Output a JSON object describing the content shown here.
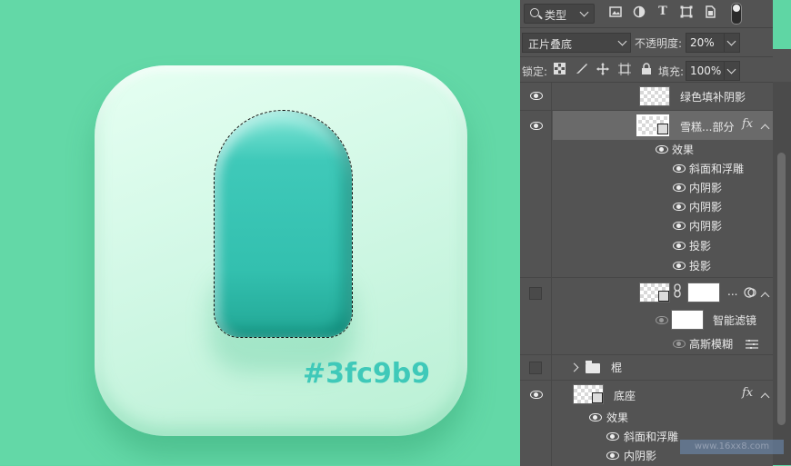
{
  "canvas": {
    "color_label": "#3fc9b9",
    "colors": {
      "background": "#63d8a7",
      "popsicle": "#3fc9b9",
      "base": "#d2f8e6"
    }
  },
  "panel": {
    "filter_kind": "类型",
    "blend_mode": "正片叠底",
    "opacity_label": "不透明度:",
    "opacity_value": "20%",
    "lock_label": "锁定:",
    "fill_label": "填充:",
    "fill_value": "100%",
    "layers": [
      {
        "name": "绿色填补阴影",
        "visible": true
      },
      {
        "name": "雪糕...部分",
        "visible": true,
        "selected": true,
        "fx": "fx",
        "effects_label": "效果",
        "effects": [
          "斜面和浮雕",
          "内阴影",
          "内阴影",
          "内阴影",
          "投影",
          "投影"
        ]
      },
      {
        "name": "...",
        "visible": false,
        "smart_filter_label": "智能滤镜",
        "filters": [
          "高斯模糊"
        ]
      },
      {
        "name": "棍",
        "visible": false,
        "type": "group"
      },
      {
        "name": "底座",
        "visible": true,
        "fx": "fx",
        "effects_label": "效果",
        "effects": [
          "斜面和浮雕",
          "内阴影"
        ]
      }
    ]
  },
  "icons": [
    "search-icon",
    "image-filter-icon",
    "adjustment-filter-icon",
    "type-filter-icon",
    "shape-filter-icon",
    "smartobject-filter-icon",
    "filter-toggle-icon",
    "lock-pixels-icon",
    "lock-brush-icon",
    "lock-move-icon",
    "lock-artboard-icon",
    "lock-all-icon",
    "eye-icon",
    "folder-icon",
    "link-icon",
    "fx-icon"
  ],
  "watermark": "www.16xx8.com"
}
